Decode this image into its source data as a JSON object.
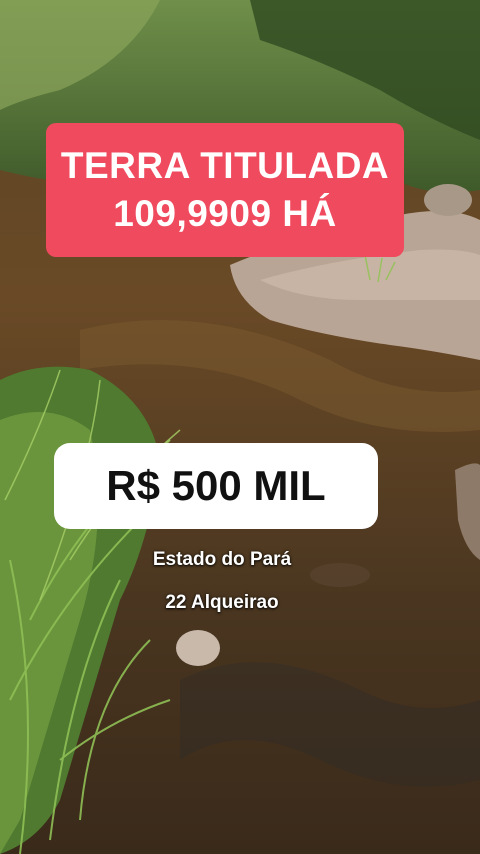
{
  "banner": {
    "line1": "TERRA TITULADA",
    "line2": "109,9909 HÁ",
    "color": "#ef4a5d"
  },
  "price": {
    "label": "R$ 500 MIL"
  },
  "details": {
    "state": "Estado do Pará",
    "size": "22 Alqueirao"
  }
}
